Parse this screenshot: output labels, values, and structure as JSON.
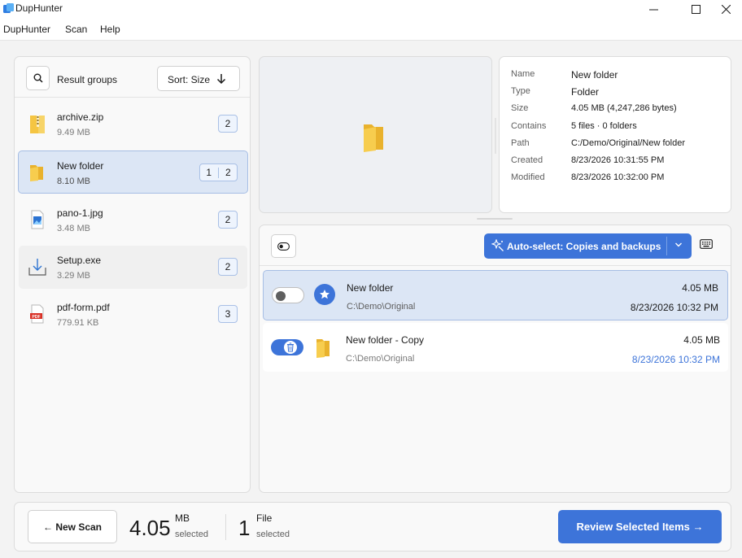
{
  "window": {
    "title": "DupHunter",
    "controls": [
      "minimize",
      "maximize",
      "close"
    ]
  },
  "menu": [
    "DupHunter",
    "Scan",
    "Help"
  ],
  "groups_panel": {
    "search_icon": "search-icon",
    "label": "Result groups",
    "sort_label": "Sort: Size",
    "sort_icon": "arrow-down-icon",
    "groups": [
      {
        "name": "archive.zip",
        "size": "9.49 MB",
        "count": "2",
        "icon": "zip-file-icon"
      },
      {
        "name": "New folder",
        "size": "8.10 MB",
        "selected_count": "1",
        "count": "2",
        "icon": "folder-icon",
        "selected": true
      },
      {
        "name": "pano-1.jpg",
        "size": "3.48 MB",
        "count": "2",
        "icon": "image-file-icon"
      },
      {
        "name": "Setup.exe",
        "size": "3.29 MB",
        "count": "2",
        "icon": "installer-icon"
      },
      {
        "name": "pdf-form.pdf",
        "size": "779.91 KB",
        "count": "3",
        "icon": "pdf-file-icon"
      }
    ]
  },
  "details": {
    "name_key": "Name",
    "name": "New folder",
    "type_key": "Type",
    "type": "Folder",
    "size_key": "Size",
    "size": "4.05 MB (4,247,286 bytes)",
    "contains_key": "Contains",
    "contains": "5 files · 0 folders",
    "path_key": "Path",
    "path": "C:/Demo/Original/New folder",
    "created_key": "Created",
    "created": "8/23/2026 10:31:55 PM",
    "modified_key": "Modified",
    "modified": "8/23/2026 10:32:00 PM"
  },
  "files_panel": {
    "auto_select_label": "Auto-select: Copies and backups",
    "files": [
      {
        "name": "New folder",
        "path": "C:\\Demo\\Original",
        "size": "4.05 MB",
        "date": "8/23/2026 10:32 PM",
        "toggle": "off",
        "badge": "star-icon",
        "selected": true
      },
      {
        "name": "New folder - Copy",
        "path": "C:\\Demo\\Original",
        "size": "4.05 MB",
        "date": "8/23/2026 10:32 PM",
        "toggle": "on",
        "badge": "folder-icon",
        "selected": false
      }
    ]
  },
  "footer": {
    "new_scan_label": "← New Scan",
    "size_value": "4.05",
    "size_unit": "MB",
    "size_sub": "selected",
    "count_value": "1",
    "count_unit": "File",
    "count_sub": "selected",
    "review_label": "Review Selected Items →"
  },
  "colors": {
    "accent": "#3d74d9",
    "selection_bg": "#dce6f5",
    "folder": "#f5c542"
  }
}
